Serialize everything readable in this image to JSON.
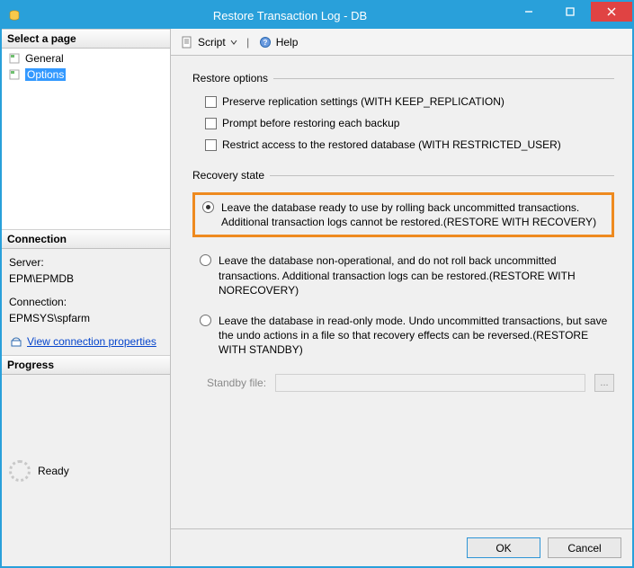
{
  "window": {
    "title": "Restore Transaction Log  -  DB"
  },
  "sidebar": {
    "select_page_header": "Select a page",
    "items": [
      {
        "label": "General"
      },
      {
        "label": "Options"
      }
    ],
    "connection_header": "Connection",
    "server_label": "Server:",
    "server_value": "EPM\\EPMDB",
    "connection_label": "Connection:",
    "connection_value": "EPMSYS\\spfarm",
    "view_props_link": "View connection properties",
    "progress_header": "Progress",
    "progress_status": "Ready"
  },
  "toolbar": {
    "script_label": "Script",
    "help_label": "Help"
  },
  "restore_options": {
    "group_label": "Restore options",
    "chk1": "Preserve replication settings (WITH KEEP_REPLICATION)",
    "chk2": "Prompt before restoring each backup",
    "chk3": "Restrict access to the restored database (WITH RESTRICTED_USER)"
  },
  "recovery_state": {
    "group_label": "Recovery state",
    "opt1": "Leave the database ready to use by rolling back uncommitted transactions. Additional transaction logs cannot be restored.(RESTORE WITH RECOVERY)",
    "opt2": "Leave the database non-operational, and do not roll back uncommitted transactions. Additional transaction logs can be restored.(RESTORE WITH NORECOVERY)",
    "opt3": "Leave the database in read-only mode. Undo uncommitted transactions, but save the undo actions in a file so that recovery effects can be reversed.(RESTORE WITH STANDBY)",
    "standby_label": "Standby file:",
    "standby_browse": "..."
  },
  "footer": {
    "ok": "OK",
    "cancel": "Cancel"
  }
}
